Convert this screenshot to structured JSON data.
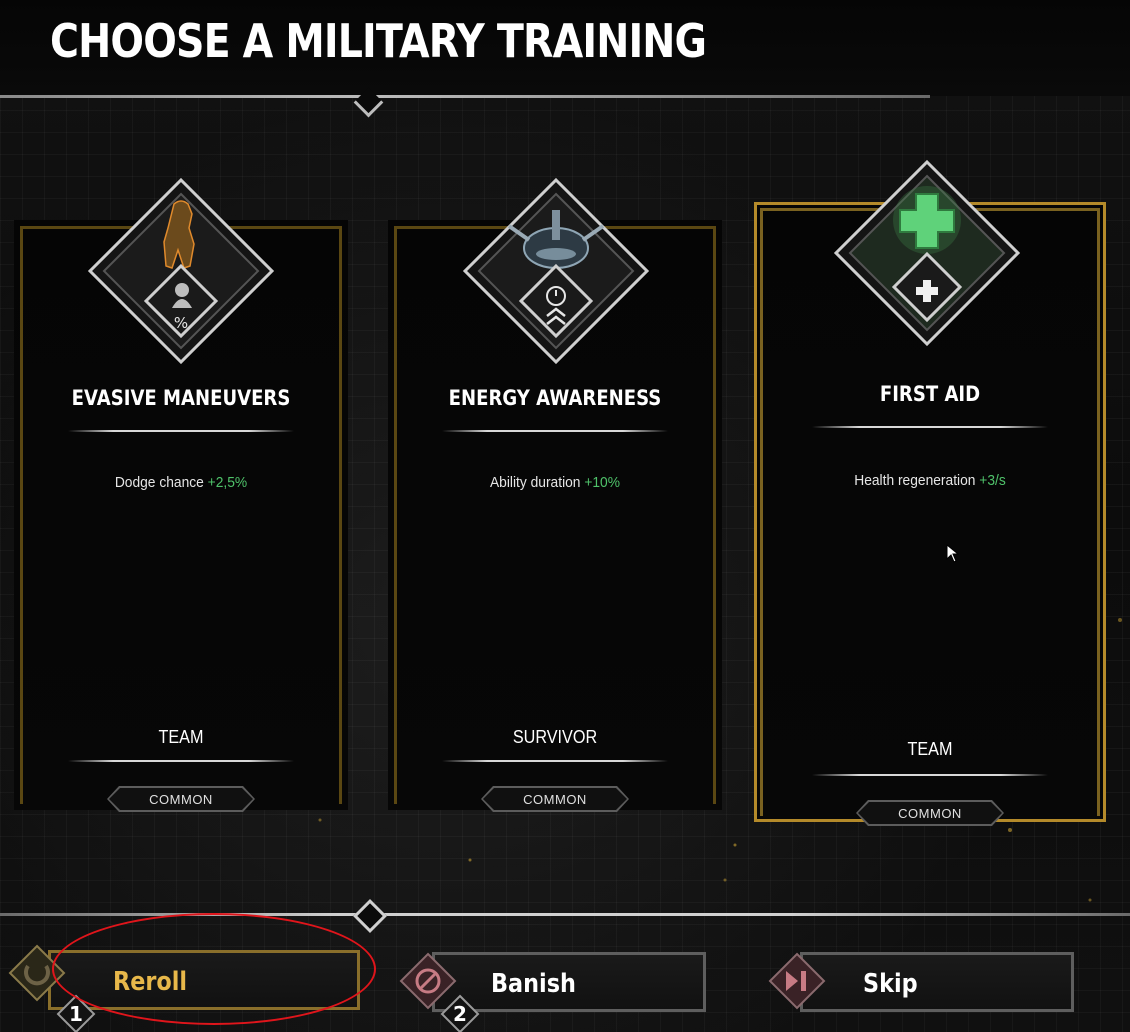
{
  "screen": {
    "title": "CHOOSE A MILITARY TRAINING"
  },
  "cards": [
    {
      "name": "EVASIVE MANEUVERS",
      "stat_label": "Dodge chance",
      "stat_bonus": "+2,5%",
      "category": "TEAM",
      "rarity": "COMMON",
      "icon": "evasion-soldier-icon",
      "selected": false
    },
    {
      "name": "ENERGY AWARENESS",
      "stat_label": "Ability duration",
      "stat_bonus": "+10%",
      "category": "SURVIVOR",
      "rarity": "COMMON",
      "icon": "energy-device-icon",
      "selected": false
    },
    {
      "name": "FIRST AID",
      "stat_label": "Health regeneration",
      "stat_bonus": "+3/s",
      "category": "TEAM",
      "rarity": "COMMON",
      "icon": "medical-cross-icon",
      "selected": true
    }
  ],
  "actions": [
    {
      "label": "Reroll",
      "hotkey": "1",
      "icon": "reroll-icon"
    },
    {
      "label": "Banish",
      "hotkey": "2",
      "icon": "banish-icon"
    },
    {
      "label": "Skip",
      "hotkey": "",
      "icon": "skip-icon"
    }
  ],
  "colors": {
    "accent_gold": "#b48a2a",
    "bonus_green": "#4fc26a",
    "annotation_red": "#e0151b",
    "reroll_text": "#e8b84a"
  }
}
